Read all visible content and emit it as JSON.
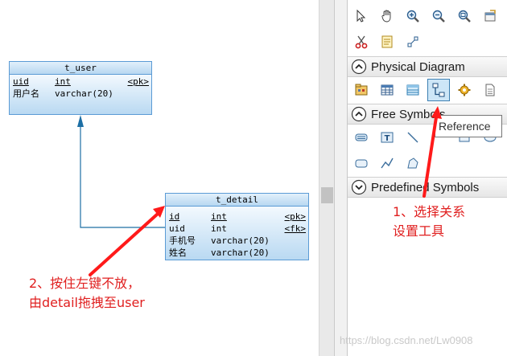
{
  "entities": {
    "t_user": {
      "name": "t_user",
      "rows": [
        {
          "name": "uid",
          "type": "int",
          "key": "<pk>"
        },
        {
          "name": "用户名",
          "type": "varchar(20)",
          "key": ""
        }
      ]
    },
    "t_detail": {
      "name": "t_detail",
      "rows": [
        {
          "name": "id",
          "type": "int",
          "key": "<pk>"
        },
        {
          "name": "uid",
          "type": "int",
          "key": "<fk>"
        },
        {
          "name": "手机号",
          "type": "varchar(20)",
          "key": ""
        },
        {
          "name": "姓名",
          "type": "varchar(20)",
          "key": ""
        }
      ]
    }
  },
  "annotations": {
    "step1_line1": "1、选择关系",
    "step1_line2": "设置工具",
    "step2_line1": "2、按住左键不放，",
    "step2_line2": "由detail拖拽至user"
  },
  "palette": {
    "sections": {
      "physical": "Physical Diagram",
      "free": "Free Symbols",
      "predefined": "Predefined Symbols"
    },
    "tooltip": "Reference",
    "top_tools": [
      "pointer-icon",
      "hand-icon",
      "zoom-in-icon",
      "zoom-out-icon",
      "zoom-fit-icon",
      "properties-icon",
      "cut-icon",
      "notes-icon",
      "link-tool-icon"
    ],
    "physical_tools": [
      "package-icon",
      "table-icon",
      "view-icon",
      "reference-icon",
      "procedure-icon",
      "file-icon"
    ],
    "free_tools": [
      "text-box-icon",
      "text-icon",
      "line-icon",
      "rounded-rect-icon",
      "polyline-icon",
      "freeform-icon"
    ]
  },
  "colors": {
    "annotation": "#e01f1f",
    "entity_border": "#5b9bd5",
    "connector": "#1d6fa5"
  },
  "watermark": "https://blog.csdn.net/Lw0908"
}
